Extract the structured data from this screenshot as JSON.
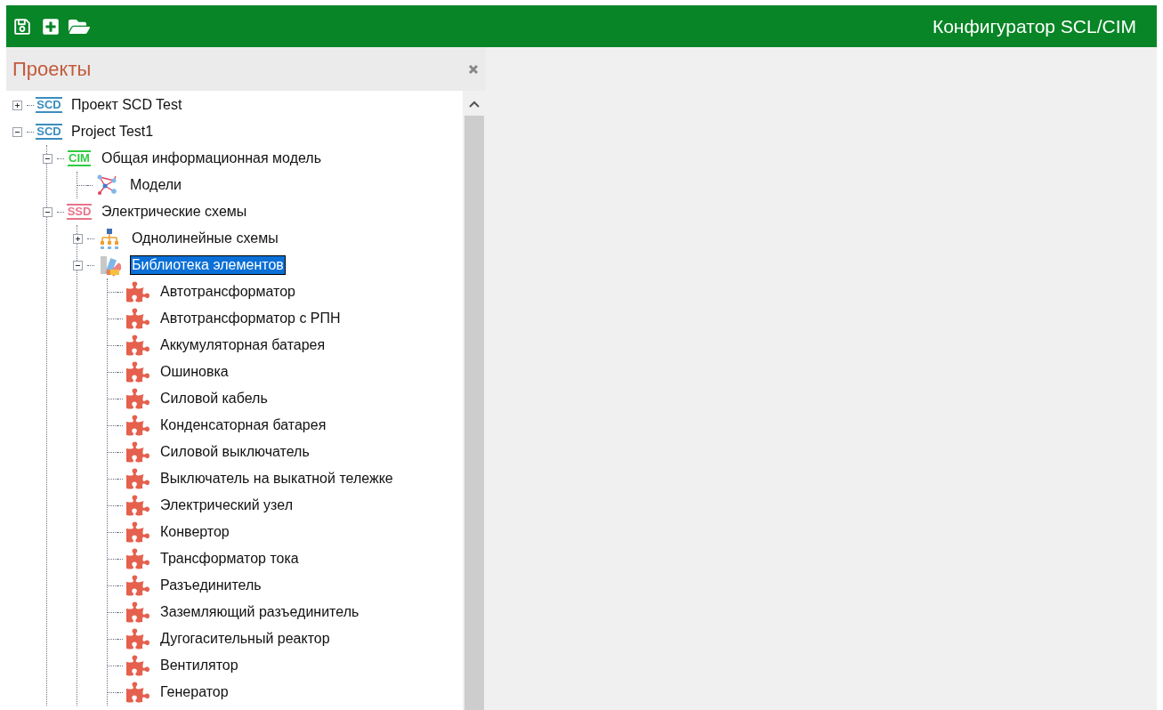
{
  "header": {
    "title": "Конфигуратор SCL/CIM"
  },
  "panel": {
    "title": "Проекты"
  },
  "tree": [
    {
      "label": "Проект SCD Test",
      "kind": "badge",
      "badge": "SCD",
      "color": "#3a8dbf",
      "expanded": false,
      "selected": false
    },
    {
      "label": "Project Test1",
      "kind": "badge",
      "badge": "SCD",
      "color": "#3a8dbf",
      "expanded": true,
      "selected": false,
      "children": [
        {
          "label": "Общая информационная модель",
          "kind": "badge",
          "badge": "CIM",
          "color": "#2ecc40",
          "expanded": true,
          "selected": false,
          "children": [
            {
              "label": "Модели",
              "kind": "models",
              "selected": false
            }
          ]
        },
        {
          "label": "Электрические схемы",
          "kind": "badge",
          "badge": "SSD",
          "color": "#e8738a",
          "expanded": true,
          "selected": false,
          "children": [
            {
              "label": "Однолинейные схемы",
              "kind": "hierarchy",
              "expanded": false,
              "selected": false
            },
            {
              "label": "Библиотека элементов",
              "kind": "palette",
              "expanded": true,
              "selected": true,
              "children": [
                {
                  "label": "Автотрансформатор",
                  "kind": "element",
                  "selected": false
                },
                {
                  "label": "Автотрансформатор с РПН",
                  "kind": "element",
                  "selected": false
                },
                {
                  "label": "Аккумуляторная батарея",
                  "kind": "element",
                  "selected": false
                },
                {
                  "label": "Ошиновка",
                  "kind": "element",
                  "selected": false
                },
                {
                  "label": "Силовой кабель",
                  "kind": "element",
                  "selected": false
                },
                {
                  "label": "Конденсаторная батарея",
                  "kind": "element",
                  "selected": false
                },
                {
                  "label": "Силовой выключатель",
                  "kind": "element",
                  "selected": false
                },
                {
                  "label": "Выключатель на выкатной тележке",
                  "kind": "element",
                  "selected": false
                },
                {
                  "label": "Электрический узел",
                  "kind": "element",
                  "selected": false
                },
                {
                  "label": "Конвертор",
                  "kind": "element",
                  "selected": false
                },
                {
                  "label": "Трансформатор тока",
                  "kind": "element",
                  "selected": false
                },
                {
                  "label": "Разъединитель",
                  "kind": "element",
                  "selected": false
                },
                {
                  "label": "Заземляющий разъединитель",
                  "kind": "element",
                  "selected": false
                },
                {
                  "label": "Дугогасительный реактор",
                  "kind": "element",
                  "selected": false
                },
                {
                  "label": "Вентилятор",
                  "kind": "element",
                  "selected": false
                },
                {
                  "label": "Генератор",
                  "kind": "element",
                  "selected": false
                }
              ]
            }
          ]
        }
      ]
    }
  ]
}
